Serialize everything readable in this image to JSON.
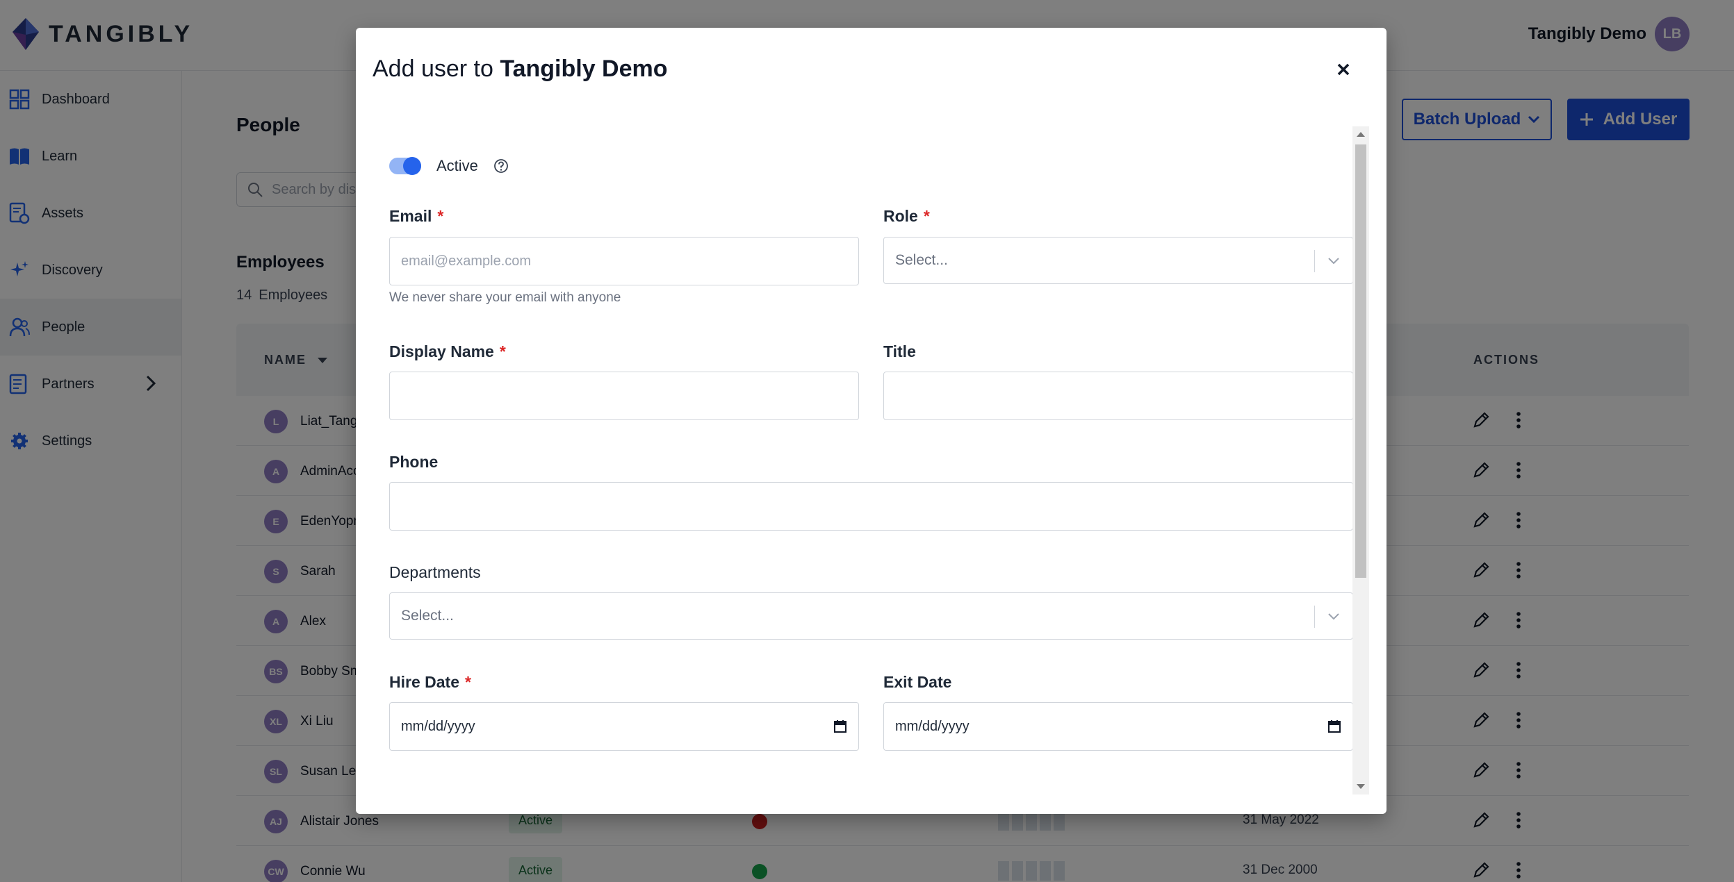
{
  "app": {
    "brand": "TANGIBLY",
    "account_name": "Tangibly Demo",
    "account_initials": "LB"
  },
  "sidebar": {
    "items": [
      {
        "label": "Dashboard",
        "icon": "dashboard-icon"
      },
      {
        "label": "Learn",
        "icon": "book-icon"
      },
      {
        "label": "Assets",
        "icon": "assets-icon"
      },
      {
        "label": "Discovery",
        "icon": "sparkle-icon"
      },
      {
        "label": "People",
        "icon": "people-icon"
      },
      {
        "label": "Partners",
        "icon": "partners-icon"
      },
      {
        "label": "Settings",
        "icon": "gear-icon"
      }
    ]
  },
  "page": {
    "title": "People",
    "search_placeholder": "Search by dis",
    "batch_upload_label": "Batch Upload",
    "add_user_label": "Add User",
    "employees_title": "Employees",
    "employees_count": "14",
    "employees_count_label": "Employees"
  },
  "table": {
    "headers": {
      "name": "NAME",
      "actions": "ACTIONS"
    },
    "rows": [
      {
        "initials": "L",
        "name": "Liat_Tang",
        "status": "",
        "date": ""
      },
      {
        "initials": "A",
        "name": "AdminAcc",
        "status": "",
        "date": ""
      },
      {
        "initials": "E",
        "name": "EdenYopm",
        "status": "",
        "date": ""
      },
      {
        "initials": "S",
        "name": "Sarah",
        "status": "",
        "date": ""
      },
      {
        "initials": "A",
        "name": "Alex",
        "status": "",
        "date": ""
      },
      {
        "initials": "BS",
        "name": "Bobby Sm",
        "status": "",
        "date": ""
      },
      {
        "initials": "XL",
        "name": "Xi Liu",
        "status": "",
        "date": ""
      },
      {
        "initials": "SL",
        "name": "Susan Lee",
        "status": "",
        "date": ""
      },
      {
        "initials": "AJ",
        "name": "Alistair Jones",
        "status": "Active",
        "date": "31 May 2022",
        "dot_color": "#c81e1e"
      },
      {
        "initials": "CW",
        "name": "Connie Wu",
        "status": "Active",
        "date": "31 Dec 2000",
        "dot_color": "#16a34a"
      }
    ]
  },
  "modal": {
    "title_prefix": "Add user to",
    "title_org": "Tangibly Demo",
    "active_label": "Active",
    "email": {
      "label": "Email",
      "placeholder": "email@example.com",
      "help": "We never share your email with anyone"
    },
    "role": {
      "label": "Role",
      "placeholder": "Select..."
    },
    "display_name": {
      "label": "Display Name"
    },
    "title_field": {
      "label": "Title"
    },
    "phone": {
      "label": "Phone"
    },
    "departments": {
      "label": "Departments",
      "placeholder": "Select..."
    },
    "hire_date": {
      "label": "Hire Date",
      "placeholder": "mm/dd/yyyy"
    },
    "exit_date": {
      "label": "Exit Date",
      "placeholder": "mm/dd/yyyy"
    },
    "required_mark": "*"
  },
  "colors": {
    "primary": "#1d4ed8",
    "required": "#dc2626",
    "avatar": "#8e7cc3",
    "toggle_on": "#2563eb"
  }
}
